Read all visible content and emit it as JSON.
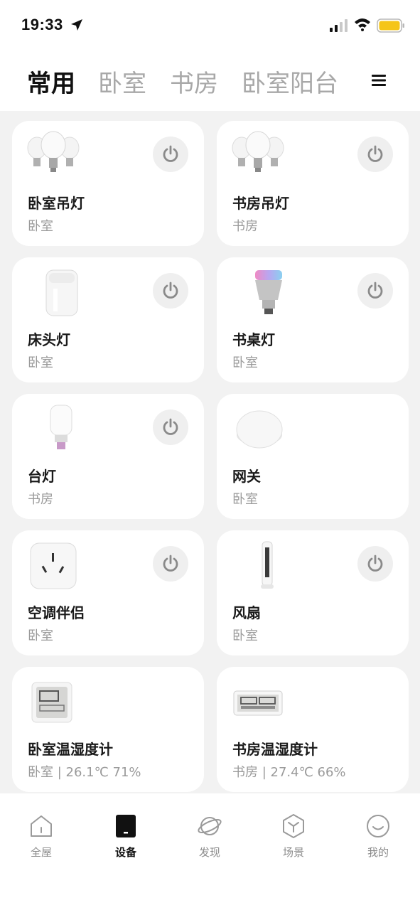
{
  "status_bar": {
    "time": "19:33",
    "icons": [
      "location-arrow-icon",
      "signal-icon",
      "wifi-icon",
      "battery-icon"
    ],
    "battery_color": "#f5c518"
  },
  "tabs": [
    {
      "label": "常用",
      "active": true
    },
    {
      "label": "卧室",
      "active": false
    },
    {
      "label": "书房",
      "active": false
    },
    {
      "label": "卧室阳台",
      "active": false
    }
  ],
  "menu_icon": "hamburger-menu-icon",
  "devices": [
    {
      "name": "卧室吊灯",
      "sub": "卧室",
      "icon": "triple-bulb-icon",
      "has_power": true
    },
    {
      "name": "书房吊灯",
      "sub": "书房",
      "icon": "triple-bulb-icon",
      "has_power": true
    },
    {
      "name": "床头灯",
      "sub": "卧室",
      "icon": "bedside-lamp-icon",
      "has_power": true
    },
    {
      "name": "书桌灯",
      "sub": "卧室",
      "icon": "color-bulb-icon",
      "has_power": true
    },
    {
      "name": "台灯",
      "sub": "书房",
      "icon": "white-bulb-icon",
      "has_power": true
    },
    {
      "name": "网关",
      "sub": "卧室",
      "icon": "gateway-icon",
      "has_power": false
    },
    {
      "name": "空调伴侣",
      "sub": "卧室",
      "icon": "ac-companion-icon",
      "has_power": true
    },
    {
      "name": "风扇",
      "sub": "卧室",
      "icon": "tower-fan-icon",
      "has_power": true
    },
    {
      "name": "卧室温湿度计",
      "sub": "卧室 | 26.1℃ 71%",
      "icon": "thermo-hygrometer-icon",
      "has_power": false
    },
    {
      "name": "书房温湿度计",
      "sub": "书房 | 27.4℃ 66%",
      "icon": "clock-thermometer-icon",
      "has_power": false
    }
  ],
  "bottom_nav": [
    {
      "label": "全屋",
      "icon": "home-icon",
      "active": false
    },
    {
      "label": "设备",
      "icon": "device-icon",
      "active": true
    },
    {
      "label": "发现",
      "icon": "planet-icon",
      "active": false
    },
    {
      "label": "场景",
      "icon": "cube-icon",
      "active": false
    },
    {
      "label": "我的",
      "icon": "smiley-icon",
      "active": false
    }
  ]
}
